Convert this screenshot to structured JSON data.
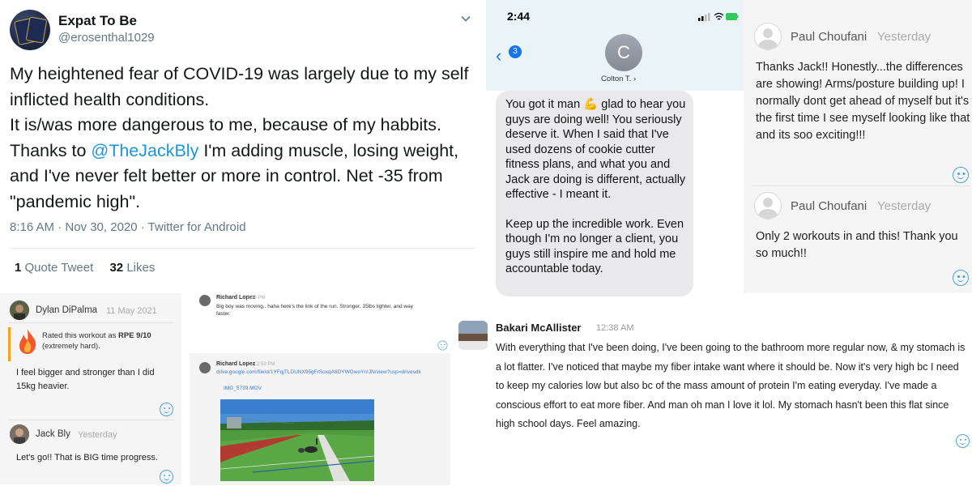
{
  "tweet": {
    "name": "Expat To Be",
    "handle": "@erosenthal1029",
    "body_before": "My heightened fear of COVID-19 was largely due to my self inflicted health conditions.",
    "body_line2": "It is/was more dangerous to me, because of my habbits.",
    "body_thanks": "Thanks to ",
    "mention": "@TheJackBly",
    "body_after": " I'm adding muscle, losing weight, and I've never felt better or more in control. Net -35 from \"pandemic high\".",
    "meta": "8:16 AM · Nov 30, 2020 · Twitter for Android",
    "quote_count": "1",
    "quote_label": " Quote Tweet",
    "likes_count": "32",
    "likes_label": " Likes"
  },
  "dylan_card": {
    "name": "Dylan DiPalma",
    "date": "11 May 2021",
    "rpe_prefix": "Rated this workout as ",
    "rpe_value": "RPE 9/10",
    "rpe_suffix": "(extremely hard).",
    "body": "I feel bigger and stronger than I did 15kg heavier.",
    "reply_name": "Jack Bly",
    "reply_date": "Yesterday",
    "reply_body": "Let's go!! That is BIG time progress."
  },
  "richard_card": {
    "name": "Richard Lopez",
    "time1": "2:59 PM",
    "text1": "Big boy was moving.. haha here's the link of the run. Stronger, 25lbs lighter, and way faster.",
    "name2": "Richard Lopez",
    "time2": "2:59 PM",
    "link": "drive.google.com/file/d/1YFqjTLDUNX95gFrSoxqA8DYWGwoYn!JN/view?usp=drivesdk",
    "file": "IMG_5739.MOV"
  },
  "imessage": {
    "status_time": "2:44",
    "back_badge": "3",
    "contact_initial": "C",
    "contact_name": "Colton T. ›",
    "msg_p1": "You got it man 💪 glad to hear you guys are doing well! You seriously deserve it. When I said that I've used dozens of cookie cutter fitness plans, and what you and Jack are doing is different, actually effective - I meant it.",
    "msg_p2": "Keep up the incredible work. Even though I'm no longer a client, you guys still inspire me and hold me accountable today."
  },
  "paul_card": {
    "name1": "Paul Choufani",
    "date1": "Yesterday",
    "text1": "Thanks Jack!! Honestly...the differences are showing! Arms/posture building up! I normally dont get ahead of myself but it's the first time I see myself looking like that and its soo exciting!!!",
    "name2": "Paul Choufani",
    "date2": "Yesterday",
    "text2": "Only 2 workouts in and this! Thank you so much!!"
  },
  "bakari_card": {
    "name": "Bakari McAllister",
    "time": "12:38 AM",
    "text": "With everything that I've been doing, I've been going to the bathroom more regular now, & my stomach is a lot flatter. I've noticed that maybe my fiber intake want where it should be. Now it's very high bc I need to keep my calories low but also bc of the mass amount of protein I'm eating everyday. I've made a conscious effort to eat more fiber. And man oh man I love it lol. My stomach hasn't been this flat since high school days. Feel amazing."
  }
}
